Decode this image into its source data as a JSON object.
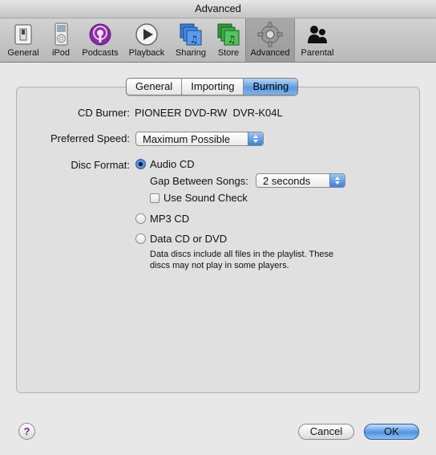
{
  "window": {
    "title": "Advanced"
  },
  "toolbar": {
    "items": [
      {
        "label": "General",
        "icon": "general-switch-icon"
      },
      {
        "label": "iPod",
        "icon": "ipod-icon"
      },
      {
        "label": "Podcasts",
        "icon": "podcasts-icon"
      },
      {
        "label": "Playback",
        "icon": "playback-icon"
      },
      {
        "label": "Sharing",
        "icon": "sharing-icon"
      },
      {
        "label": "Store",
        "icon": "store-icon"
      },
      {
        "label": "Advanced",
        "icon": "gear-icon",
        "selected": true
      },
      {
        "label": "Parental",
        "icon": "parental-icon"
      }
    ]
  },
  "tabs": [
    {
      "label": "General"
    },
    {
      "label": "Importing"
    },
    {
      "label": "Burning",
      "active": true
    }
  ],
  "burning": {
    "cd_burner_label": "CD Burner:",
    "cd_burner_value": "PIONEER DVD-RW  DVR-K04L",
    "preferred_speed_label": "Preferred Speed:",
    "preferred_speed_value": "Maximum Possible",
    "disc_format_label": "Disc Format:",
    "audio_cd_label": "Audio CD",
    "gap_label": "Gap Between Songs:",
    "gap_value": "2 seconds",
    "sound_check_label": "Use Sound Check",
    "mp3_cd_label": "MP3 CD",
    "data_cd_label": "Data CD or DVD",
    "data_note_line1": "Data discs include all files in the playlist. These",
    "data_note_line2": "discs may not play in some players.",
    "selected_format": "Audio CD",
    "sound_check_checked": false
  },
  "footer": {
    "help_label": "?",
    "cancel_label": "Cancel",
    "ok_label": "OK"
  },
  "colors": {
    "accent_blue": "#5d9be0",
    "help_icon": "#7a2a8a"
  }
}
